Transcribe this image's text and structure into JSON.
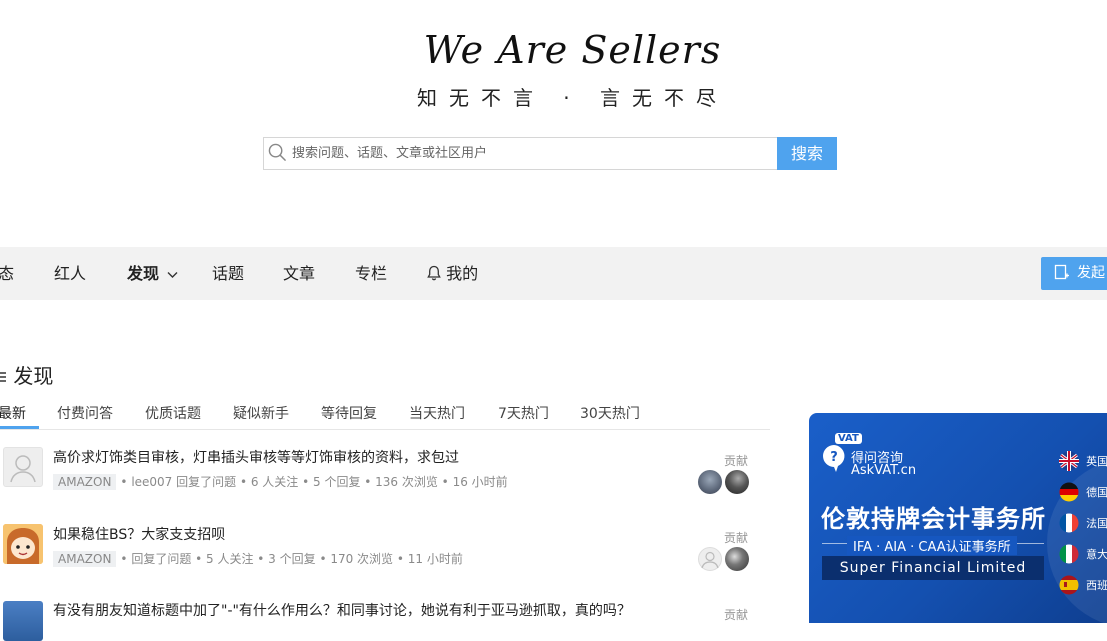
{
  "header": {
    "logo_text": "We Are Sellers",
    "slogan": "知无不言 · 言无不尽"
  },
  "search": {
    "placeholder": "搜索问题、话题、文章或社区用户",
    "button_label": "搜索"
  },
  "nav": {
    "items": [
      {
        "label": "态"
      },
      {
        "label": "红人"
      },
      {
        "label": "发现"
      },
      {
        "label": "话题"
      },
      {
        "label": "文章"
      },
      {
        "label": "专栏"
      },
      {
        "label": "我的"
      }
    ],
    "cta_label": "发起"
  },
  "section": {
    "title": "发现"
  },
  "tabs": [
    "最新",
    "付费问答",
    "优质话题",
    "疑似新手",
    "等待回复",
    "当天热门",
    "7天热门",
    "30天热门"
  ],
  "questions": [
    {
      "title": "高价求灯饰类目审核，灯串插头审核等等灯饰审核的资料，求包过",
      "tag": "AMAZON",
      "meta": "• lee007 回复了问题 • 6 人关注 • 5 个回复 • 136 次浏览 • 16 小时前",
      "contrib_label": "贡献"
    },
    {
      "title": "如果稳住BS？大家支支招呗",
      "tag": "AMAZON",
      "meta": "• 回复了问题 • 5 人关注 • 3 个回复 • 170 次浏览 • 11 小时前",
      "contrib_label": "贡献"
    },
    {
      "title": "有没有朋友知道标题中加了\"-\"有什么作用么？和同事讨论，她说有利于亚马逊抓取，真的吗？",
      "tag": "",
      "meta": "",
      "contrib_label": "贡献"
    }
  ],
  "ad": {
    "brand_cn": "得问咨询",
    "brand_en": "AskVAT.cn",
    "badge": "VAT",
    "headline": "伦敦持牌会计事务所",
    "subline": "IFA · AIA · CAA认证事务所",
    "company": "Super Financial Limited",
    "countries": [
      "英国",
      "德国",
      "法国",
      "意大",
      "西班"
    ]
  },
  "colors": {
    "accent": "#4fa3ee",
    "nav_bg": "#f2f2f2",
    "ad_bg": "#1657c0"
  }
}
